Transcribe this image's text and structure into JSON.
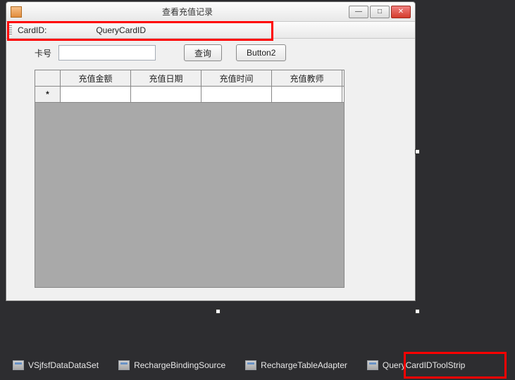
{
  "window": {
    "title": "查看充值记录"
  },
  "toolstrip": {
    "label": "CardID:",
    "text": "QueryCardID"
  },
  "form": {
    "cardLabel": "卡号",
    "queryButton": "查询",
    "button2": "Button2"
  },
  "grid": {
    "headers": [
      "充值金额",
      "充值日期",
      "充值时间",
      "充值教师"
    ],
    "newRowMarker": "*"
  },
  "tray": {
    "items": [
      "VSjfsfDataDataSet",
      "RechargeBindingSource",
      "RechargeTableAdapter",
      "QueryCardIDToolStrip"
    ]
  }
}
